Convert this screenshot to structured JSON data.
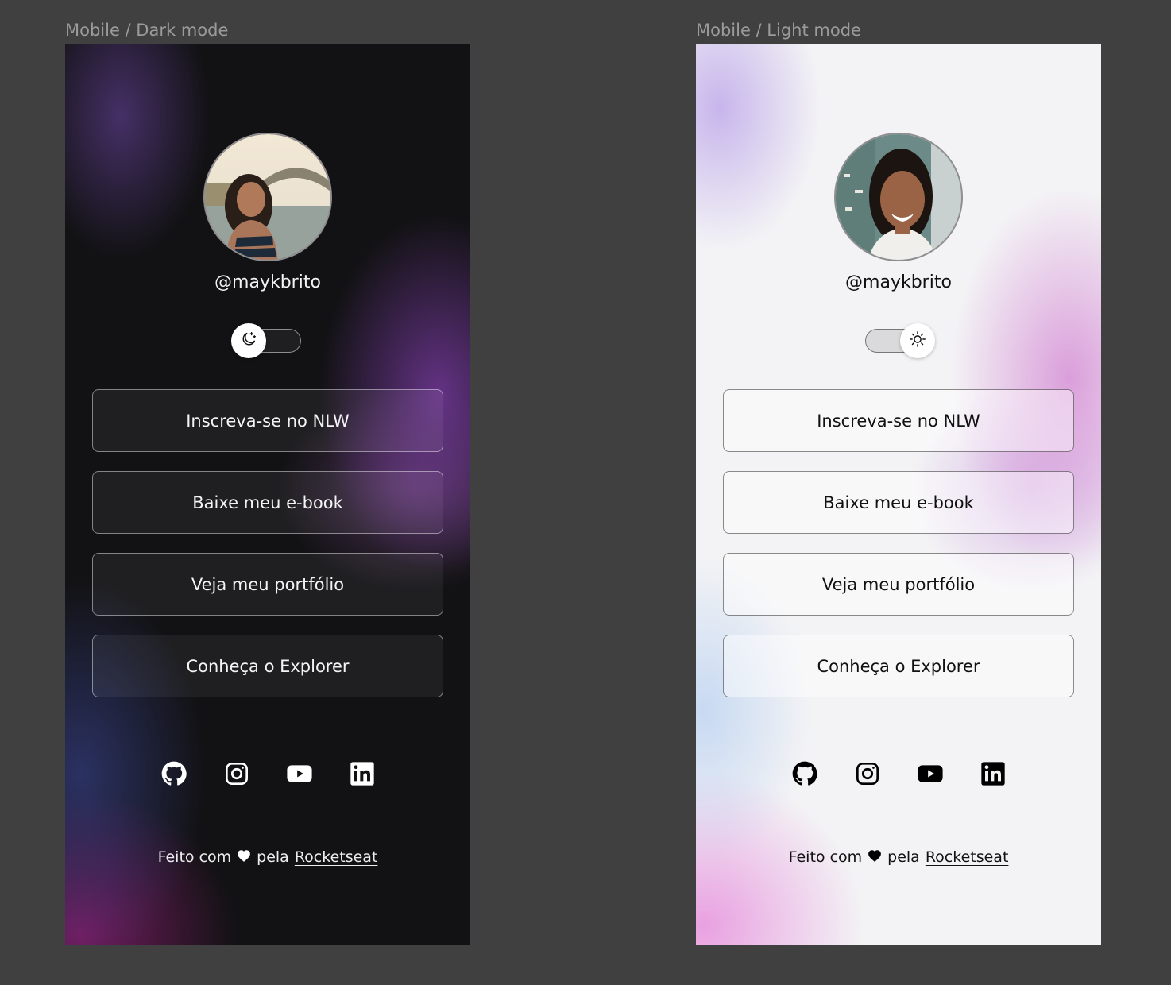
{
  "frames": {
    "dark": {
      "label": "Mobile / Dark mode",
      "handle": "@maykbrito",
      "toggle_state": "dark",
      "links": [
        "Inscreva-se no NLW",
        "Baixe meu e-book",
        "Veja meu portfólio",
        "Conheça o Explorer"
      ],
      "socials": [
        "github-icon",
        "instagram-icon",
        "youtube-icon",
        "linkedin-icon"
      ],
      "footer": {
        "prefix": "Feito com",
        "suffix": "pela",
        "link": "Rocketseat"
      }
    },
    "light": {
      "label": "Mobile / Light mode",
      "handle": "@maykbrito",
      "toggle_state": "light",
      "links": [
        "Inscreva-se no NLW",
        "Baixe meu e-book",
        "Veja meu portfólio",
        "Conheça o Explorer"
      ],
      "socials": [
        "github-icon",
        "instagram-icon",
        "youtube-icon",
        "linkedin-icon"
      ],
      "footer": {
        "prefix": "Feito com",
        "suffix": "pela",
        "link": "Rocketseat"
      }
    }
  },
  "colors": {
    "canvas": "#404040",
    "dark_bg": "#121214",
    "light_bg": "#f3f3f5",
    "accent_purple": "#8640b4",
    "accent_pink": "#e68cdc"
  }
}
